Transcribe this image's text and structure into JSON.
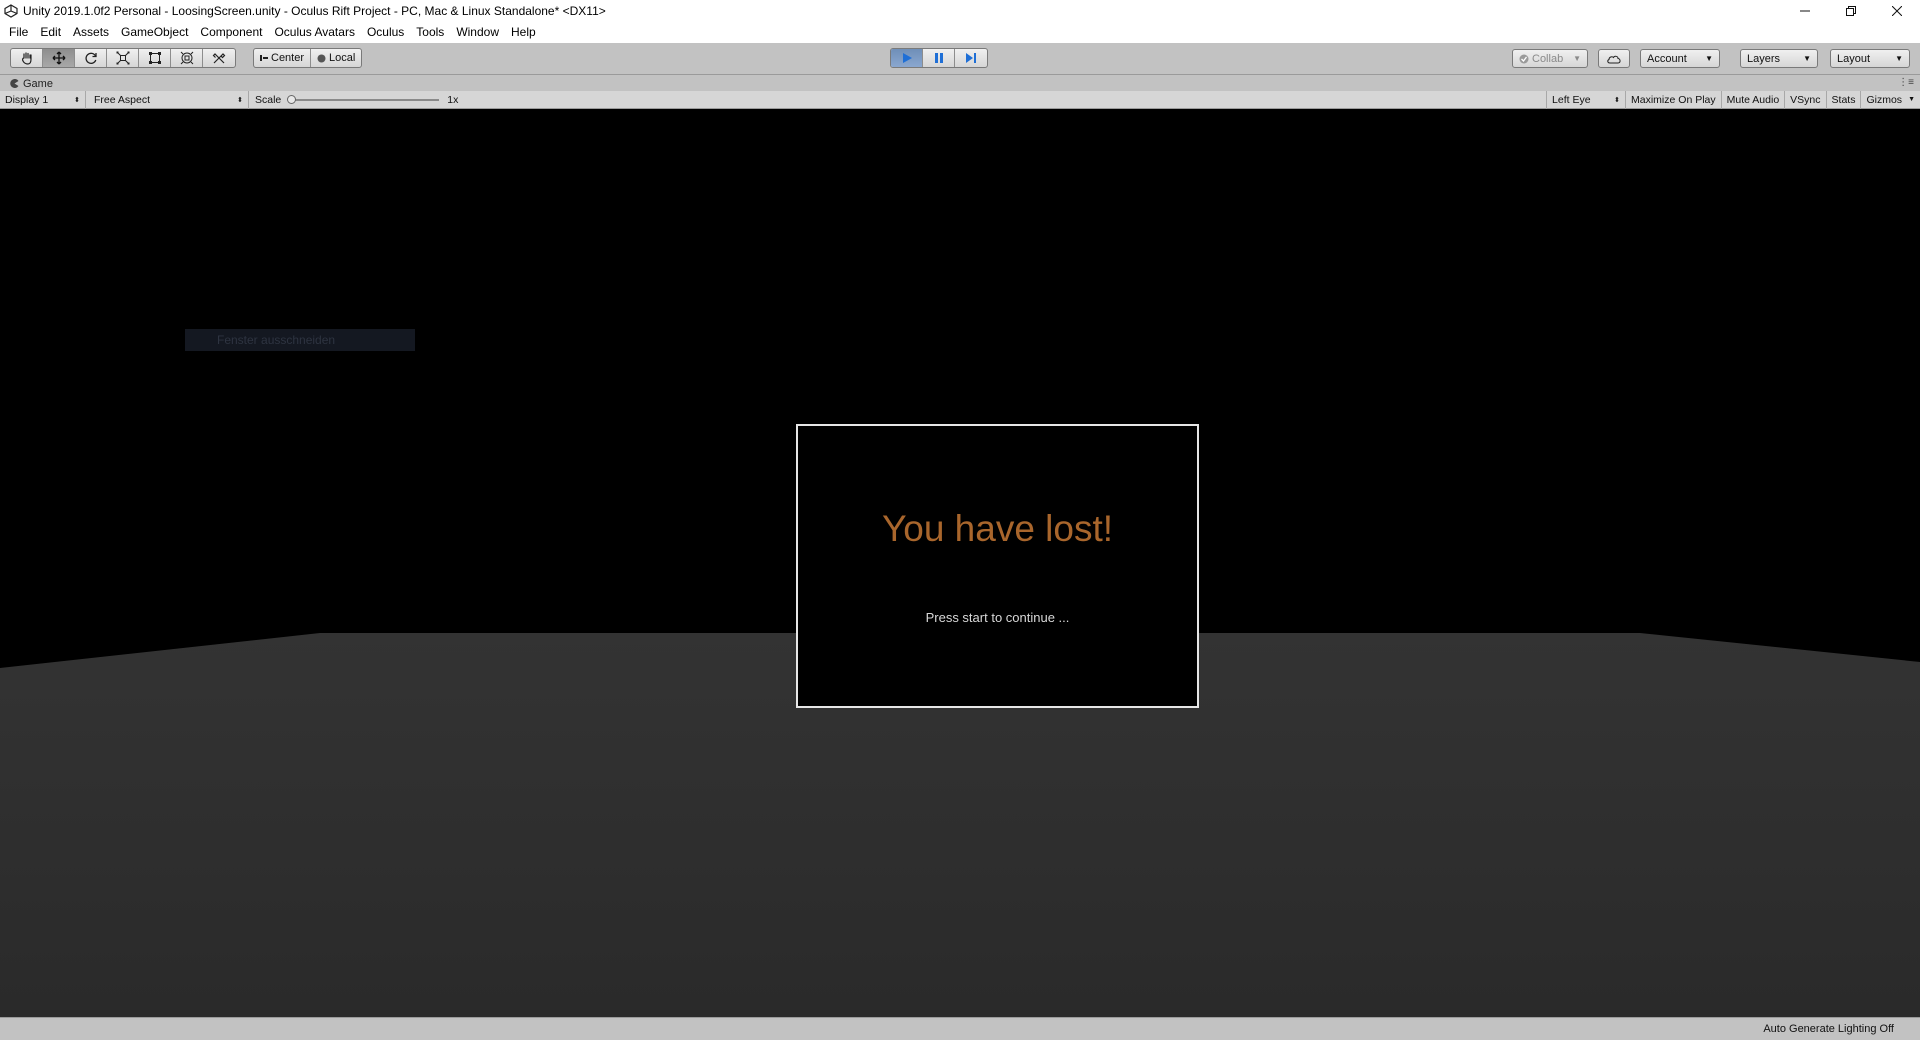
{
  "window": {
    "title": "Unity 2019.1.0f2 Personal - LoosingScreen.unity - Oculus Rift Project - PC, Mac & Linux Standalone* <DX11>"
  },
  "menu": [
    "File",
    "Edit",
    "Assets",
    "GameObject",
    "Component",
    "Oculus Avatars",
    "Oculus",
    "Tools",
    "Window",
    "Help"
  ],
  "toolbar": {
    "tools": [
      "hand-tool-icon",
      "move-tool-icon",
      "rotate-tool-icon",
      "scale-tool-icon",
      "rect-tool-icon",
      "transform-tool-icon",
      "custom-tool-icon"
    ],
    "active_tool": "move-tool-icon",
    "pivot_center_label": "Center",
    "pivot_local_label": "Local",
    "play_active": true,
    "collab_label": "Collab",
    "account_label": "Account",
    "layers_label": "Layers",
    "layout_label": "Layout"
  },
  "game_tab": {
    "label": "Game"
  },
  "game_toolbar": {
    "display": "Display 1",
    "aspect": "Free Aspect",
    "scale_label": "Scale",
    "scale_value": "1x",
    "eye": "Left Eye",
    "maximize_on_play": "Maximize On Play",
    "mute_audio": "Mute Audio",
    "vsync": "VSync",
    "stats": "Stats",
    "gizmos": "Gizmos"
  },
  "game_view": {
    "tooltip_text": "Fenster ausschneiden",
    "dialog_title": "You have lost!",
    "dialog_subtitle": "Press start to continue ...",
    "title_color": "#a9662c"
  },
  "status_bar": {
    "text": "Auto Generate Lighting Off"
  }
}
